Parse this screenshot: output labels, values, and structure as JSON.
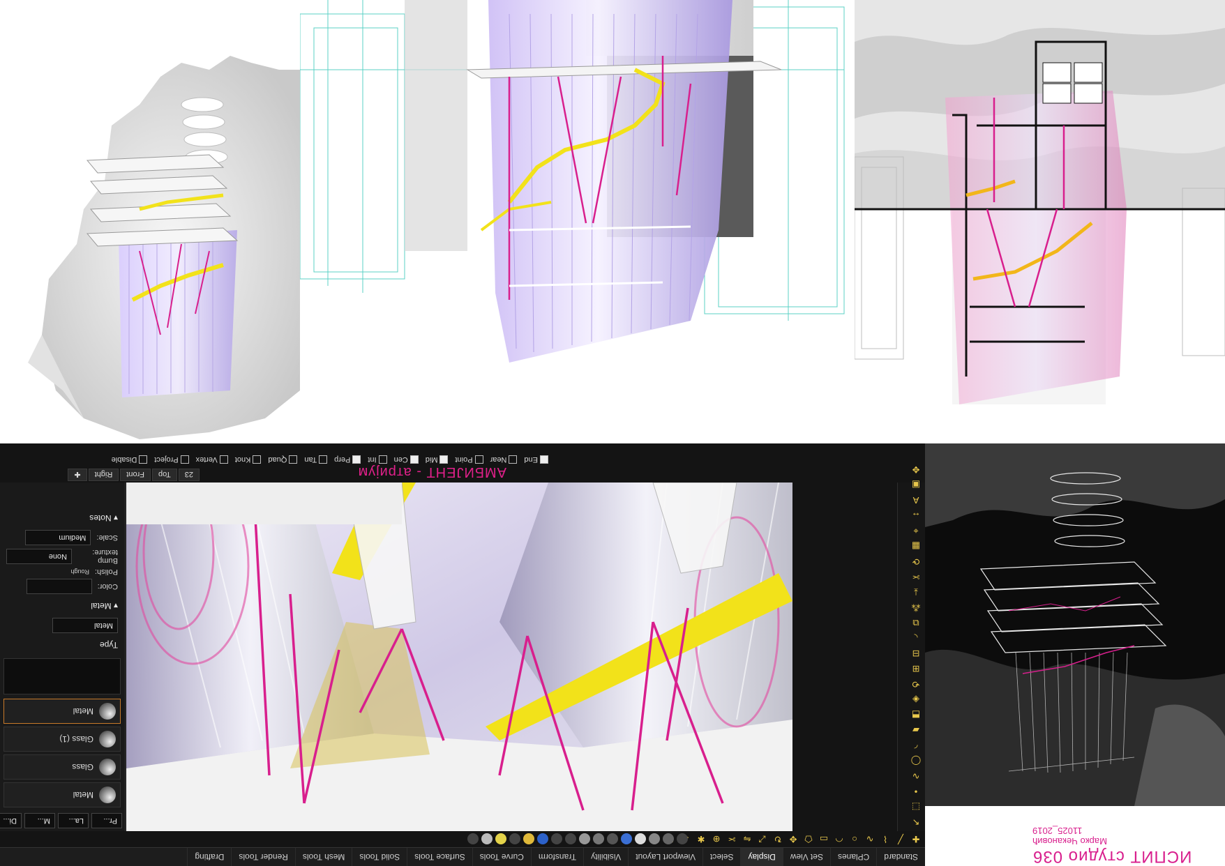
{
  "title_block": {
    "project": "ИСПИТ студио 036",
    "author": "Марко Чекановић",
    "code": "11025_2019"
  },
  "app": {
    "viewport_title": "АМБИЈЕНТ - атријум",
    "toolbar_tabs": [
      "Standard",
      "CPlanes",
      "Set View",
      "Display",
      "Select",
      "Viewport Layout",
      "Visibility",
      "Transform",
      "Curve Tools",
      "Surface Tools",
      "Solid Tools",
      "Mesh Tools",
      "Render Tools",
      "Drafting"
    ],
    "active_tab": "Display",
    "view_tabs": [
      "23",
      "Top",
      "Front",
      "Right"
    ],
    "osnap": [
      {
        "label": "End",
        "checked": true
      },
      {
        "label": "Near",
        "checked": false
      },
      {
        "label": "Point",
        "checked": false
      },
      {
        "label": "Mid",
        "checked": true
      },
      {
        "label": "Cen",
        "checked": true
      },
      {
        "label": "Int",
        "checked": false
      },
      {
        "label": "Perp",
        "checked": true
      },
      {
        "label": "Tan",
        "checked": false
      },
      {
        "label": "Quad",
        "checked": false
      },
      {
        "label": "Knot",
        "checked": false
      },
      {
        "label": "Vertex",
        "checked": false
      },
      {
        "label": "Project",
        "checked": false
      },
      {
        "label": "Disable",
        "checked": false
      }
    ],
    "panel_tabs": [
      "Pr...",
      "La...",
      "M...",
      "Di..."
    ],
    "materials": [
      {
        "name": "Metal",
        "selected": false
      },
      {
        "name": "Glass",
        "selected": false
      },
      {
        "name": "Glass (1)",
        "selected": false
      },
      {
        "name": "Metal",
        "selected": true
      }
    ],
    "type_label": "Type",
    "type_value": "Metal",
    "metal_section": "Metal",
    "color_label": "Color:",
    "polish_label": "Polish:",
    "polish_scale": "Rough",
    "bump_label": "Bump texture:",
    "bump_value": "None",
    "scale_label": "Scale:",
    "scale_value": "Medium",
    "notes_section": "Notes"
  },
  "colors": {
    "accent_magenta": "#d81f8d",
    "rail_yellow": "#f2e21a",
    "glass_lavender": "#c9b8f0",
    "ui_dark": "#141414"
  }
}
